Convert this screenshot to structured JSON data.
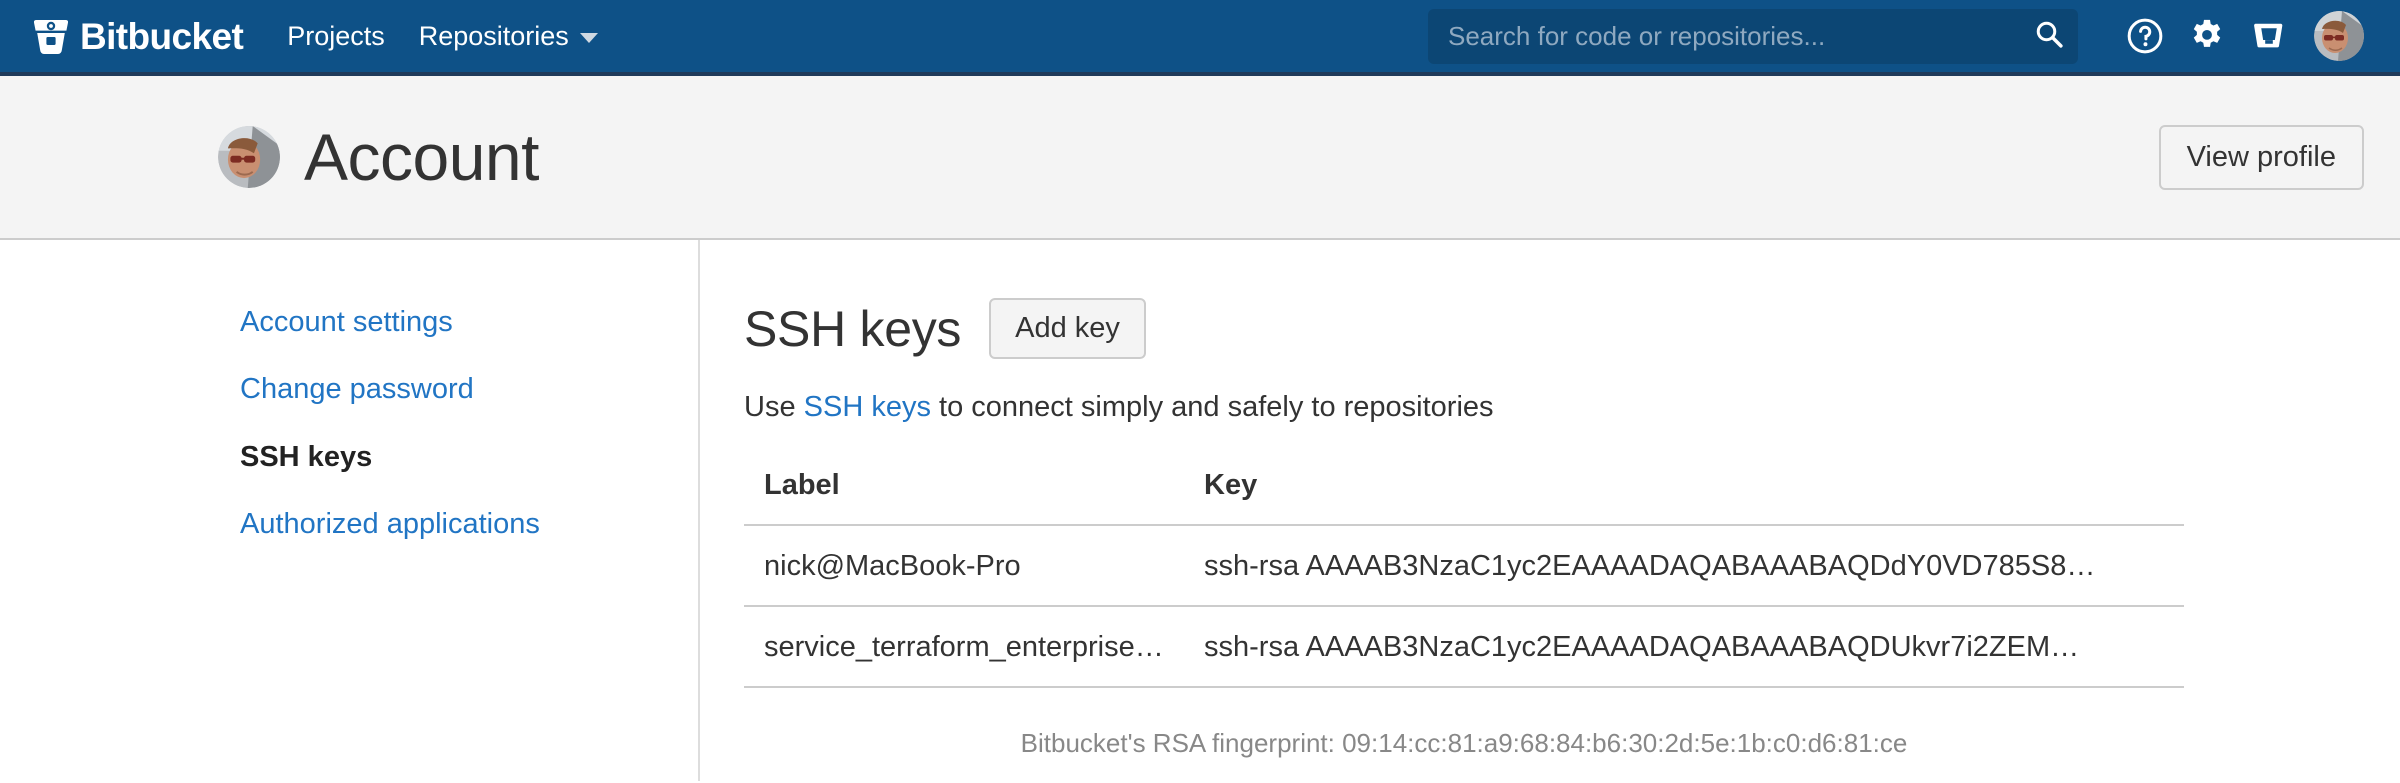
{
  "nav": {
    "brand": "Bitbucket",
    "brand_logo_icon": "bitbucket-logo-icon",
    "links": [
      {
        "label": "Projects",
        "has_caret": false
      },
      {
        "label": "Repositories",
        "has_caret": true
      }
    ],
    "search": {
      "placeholder": "Search for code or repositories...",
      "value": "",
      "icon": "search-icon"
    },
    "icons": [
      {
        "name": "help-icon",
        "glyph": "question-circle"
      },
      {
        "name": "settings-gear-icon",
        "glyph": "gear"
      },
      {
        "name": "inbox-tray-icon",
        "glyph": "tray"
      }
    ],
    "avatar_icon": "user-avatar-icon",
    "background_color": "#0e5187",
    "search_background_color": "#0c4674"
  },
  "header": {
    "avatar_icon": "profile-avatar-icon",
    "title": "Account",
    "view_profile_label": "View profile",
    "background_color": "#f4f4f4"
  },
  "sidebar": {
    "items": [
      {
        "label": "Account settings",
        "active": false
      },
      {
        "label": "Change password",
        "active": false
      },
      {
        "label": "SSH keys",
        "active": true
      },
      {
        "label": "Authorized applications",
        "active": false
      }
    ],
    "link_color": "#2175c4"
  },
  "main": {
    "section_title": "SSH keys",
    "add_key_label": "Add key",
    "lede": {
      "prefix": "Use ",
      "link_text": "SSH keys",
      "suffix": " to connect simply and safely to repositories"
    },
    "table": {
      "columns": [
        "Label",
        "Key"
      ],
      "rows": [
        {
          "label": "nick@MacBook-Pro",
          "key": "ssh-rsa AAAAB3NzaC1yc2EAAAADAQABAAABAQDdY0VD785S8…"
        },
        {
          "label": "service_terraform_enterprise…",
          "key": "ssh-rsa AAAAB3NzaC1yc2EAAAADAQABAAABAQDUkvr7i2ZEM…"
        }
      ]
    },
    "fingerprint": "Bitbucket's RSA fingerprint: 09:14:cc:81:a9:68:84:b6:30:2d:5e:1b:c0:d6:81:ce"
  }
}
